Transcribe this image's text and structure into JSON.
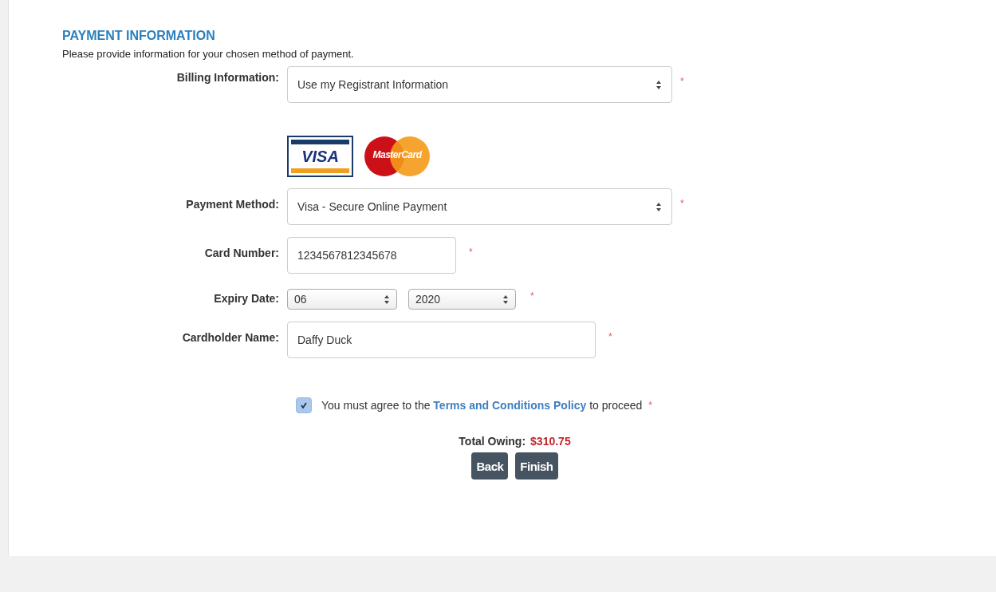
{
  "section": {
    "title": "PAYMENT INFORMATION",
    "intro": "Please provide information for your chosen method of payment."
  },
  "billing": {
    "label": "Billing Information:",
    "value": "Use my Registrant Information",
    "required": "*"
  },
  "cards": [
    {
      "kind": "visa",
      "label": "VISA",
      "selected": true
    },
    {
      "kind": "mastercard",
      "label": "MasterCard",
      "selected": false
    }
  ],
  "fields": [
    {
      "kind": "select",
      "label": "Payment Method:",
      "value": "Visa - Secure Online Payment",
      "required": "*"
    },
    {
      "kind": "text",
      "label": "Card Number:",
      "value": "1234567812345678",
      "required": "*"
    },
    {
      "kind": "date",
      "label": "Expiry Date:",
      "month": "06",
      "year": "2020",
      "required": "*"
    },
    {
      "kind": "text",
      "label": "Cardholder Name:",
      "value": "Daffy Duck",
      "required": "*"
    }
  ],
  "agreement": {
    "checked": true,
    "before": "You must agree to the",
    "link": "Terms and Conditions Policy",
    "after": "to proceed",
    "required": "*"
  },
  "total": {
    "label": "Total Owing:",
    "amount": "$310.75"
  },
  "buttons": [
    "Back",
    "Finish"
  ]
}
